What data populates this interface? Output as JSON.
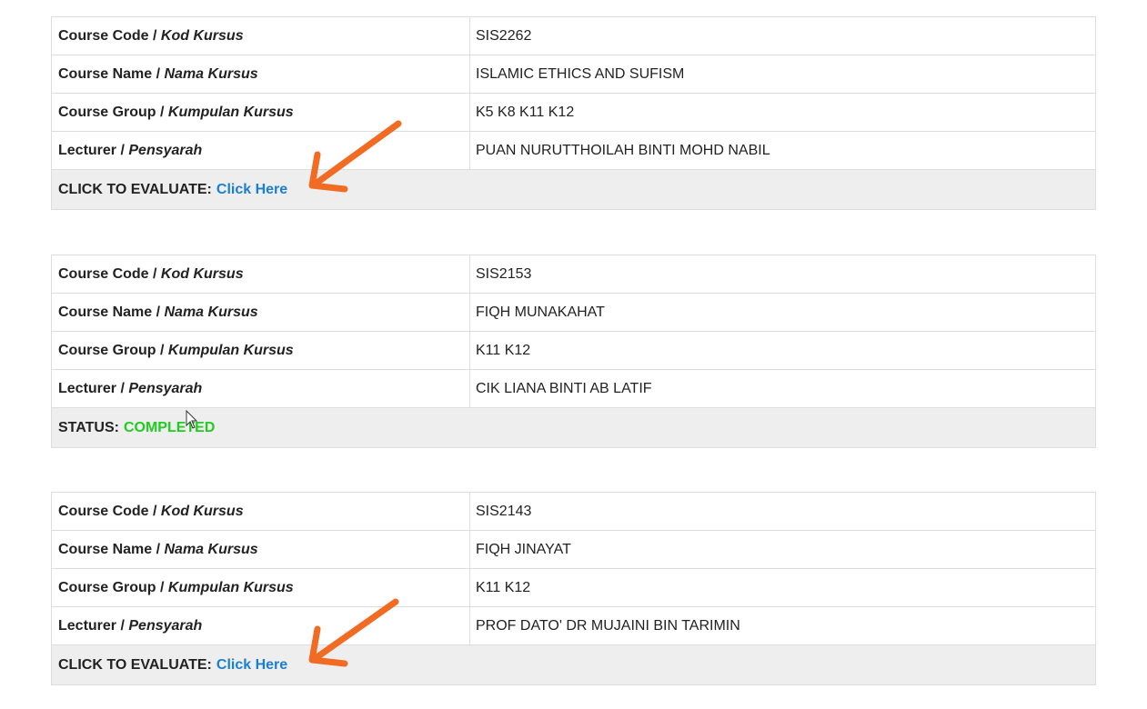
{
  "courses": [
    {
      "code_label": "Course Code",
      "code_label_ms": "Kod Kursus",
      "code": "SIS2262",
      "name_label": "Course Name",
      "name_label_ms": "Nama Kursus",
      "name": "ISLAMIC ETHICS AND SUFISM",
      "group_label": "Course Group",
      "group_label_ms": "Kumpulan Kursus",
      "group": "K5 K8 K11 K12",
      "lecturer_label": "Lecturer",
      "lecturer_label_ms": "Pensyarah",
      "lecturer": "PUAN NURUTTHOILAH BINTI MOHD NABIL",
      "footer_label": "CLICK TO EVALUATE:",
      "footer_link": "Click Here"
    },
    {
      "code_label": "Course Code",
      "code_label_ms": "Kod Kursus",
      "code": "SIS2153",
      "name_label": "Course Name",
      "name_label_ms": "Nama Kursus",
      "name": "FIQH MUNAKAHAT",
      "group_label": "Course Group",
      "group_label_ms": "Kumpulan Kursus",
      "group": "K11 K12",
      "lecturer_label": "Lecturer",
      "lecturer_label_ms": "Pensyarah",
      "lecturer": "CIK LIANA BINTI AB LATIF",
      "footer_label": "STATUS:",
      "footer_status": "COMPLETED"
    },
    {
      "code_label": "Course Code",
      "code_label_ms": "Kod Kursus",
      "code": "SIS2143",
      "name_label": "Course Name",
      "name_label_ms": "Nama Kursus",
      "name": "FIQH JINAYAT",
      "group_label": "Course Group",
      "group_label_ms": "Kumpulan Kursus",
      "group": "K11 K12",
      "lecturer_label": "Lecturer",
      "lecturer_label_ms": "Pensyarah",
      "lecturer": "PROF DATO' DR MUJAINI BIN TARIMIN",
      "footer_label": "CLICK TO EVALUATE:",
      "footer_link": "Click Here"
    }
  ],
  "colors": {
    "link": "#1a7fd1",
    "status_completed": "#1fcc1f",
    "annotation_arrow": "#f26b22",
    "footer_bg": "#eeeeee"
  }
}
